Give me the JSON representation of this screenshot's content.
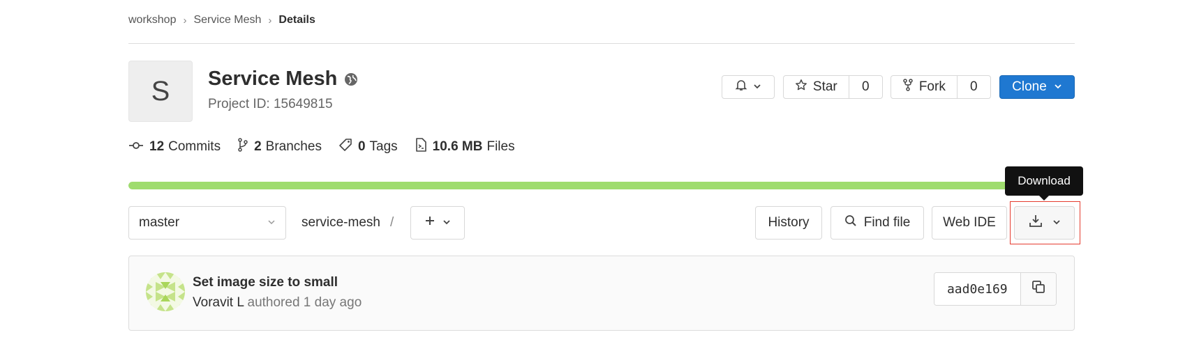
{
  "breadcrumb": {
    "items": [
      "workshop",
      "Service Mesh"
    ],
    "current": "Details"
  },
  "project": {
    "avatar_letter": "S",
    "title": "Service Mesh",
    "id_text": "Project ID: 15649815",
    "visibility_icon": "globe-icon"
  },
  "actions": {
    "notification_icon": "bell-icon",
    "star_label": "Star",
    "star_count": "0",
    "fork_label": "Fork",
    "fork_count": "0",
    "clone_label": "Clone",
    "clone_color": "#1f78d1"
  },
  "stats": {
    "commits_count": "12",
    "commits_label": "Commits",
    "branches_count": "2",
    "branches_label": "Branches",
    "tags_count": "0",
    "tags_label": "Tags",
    "files_size": "10.6 MB",
    "files_label": "Files"
  },
  "language_bar": {
    "color": "#9fdc6e",
    "fraction": 1.0
  },
  "tooltip": {
    "text": "Download"
  },
  "toolbar": {
    "branch": "master",
    "path_root": "service-mesh",
    "path_sep": "/",
    "history_label": "History",
    "find_file_label": "Find file",
    "web_ide_label": "Web IDE",
    "download_icon": "download-icon"
  },
  "last_commit": {
    "title": "Set image size to small",
    "author": "Voravit L",
    "meta": "authored 1 day ago",
    "sha": "aad0e169"
  }
}
